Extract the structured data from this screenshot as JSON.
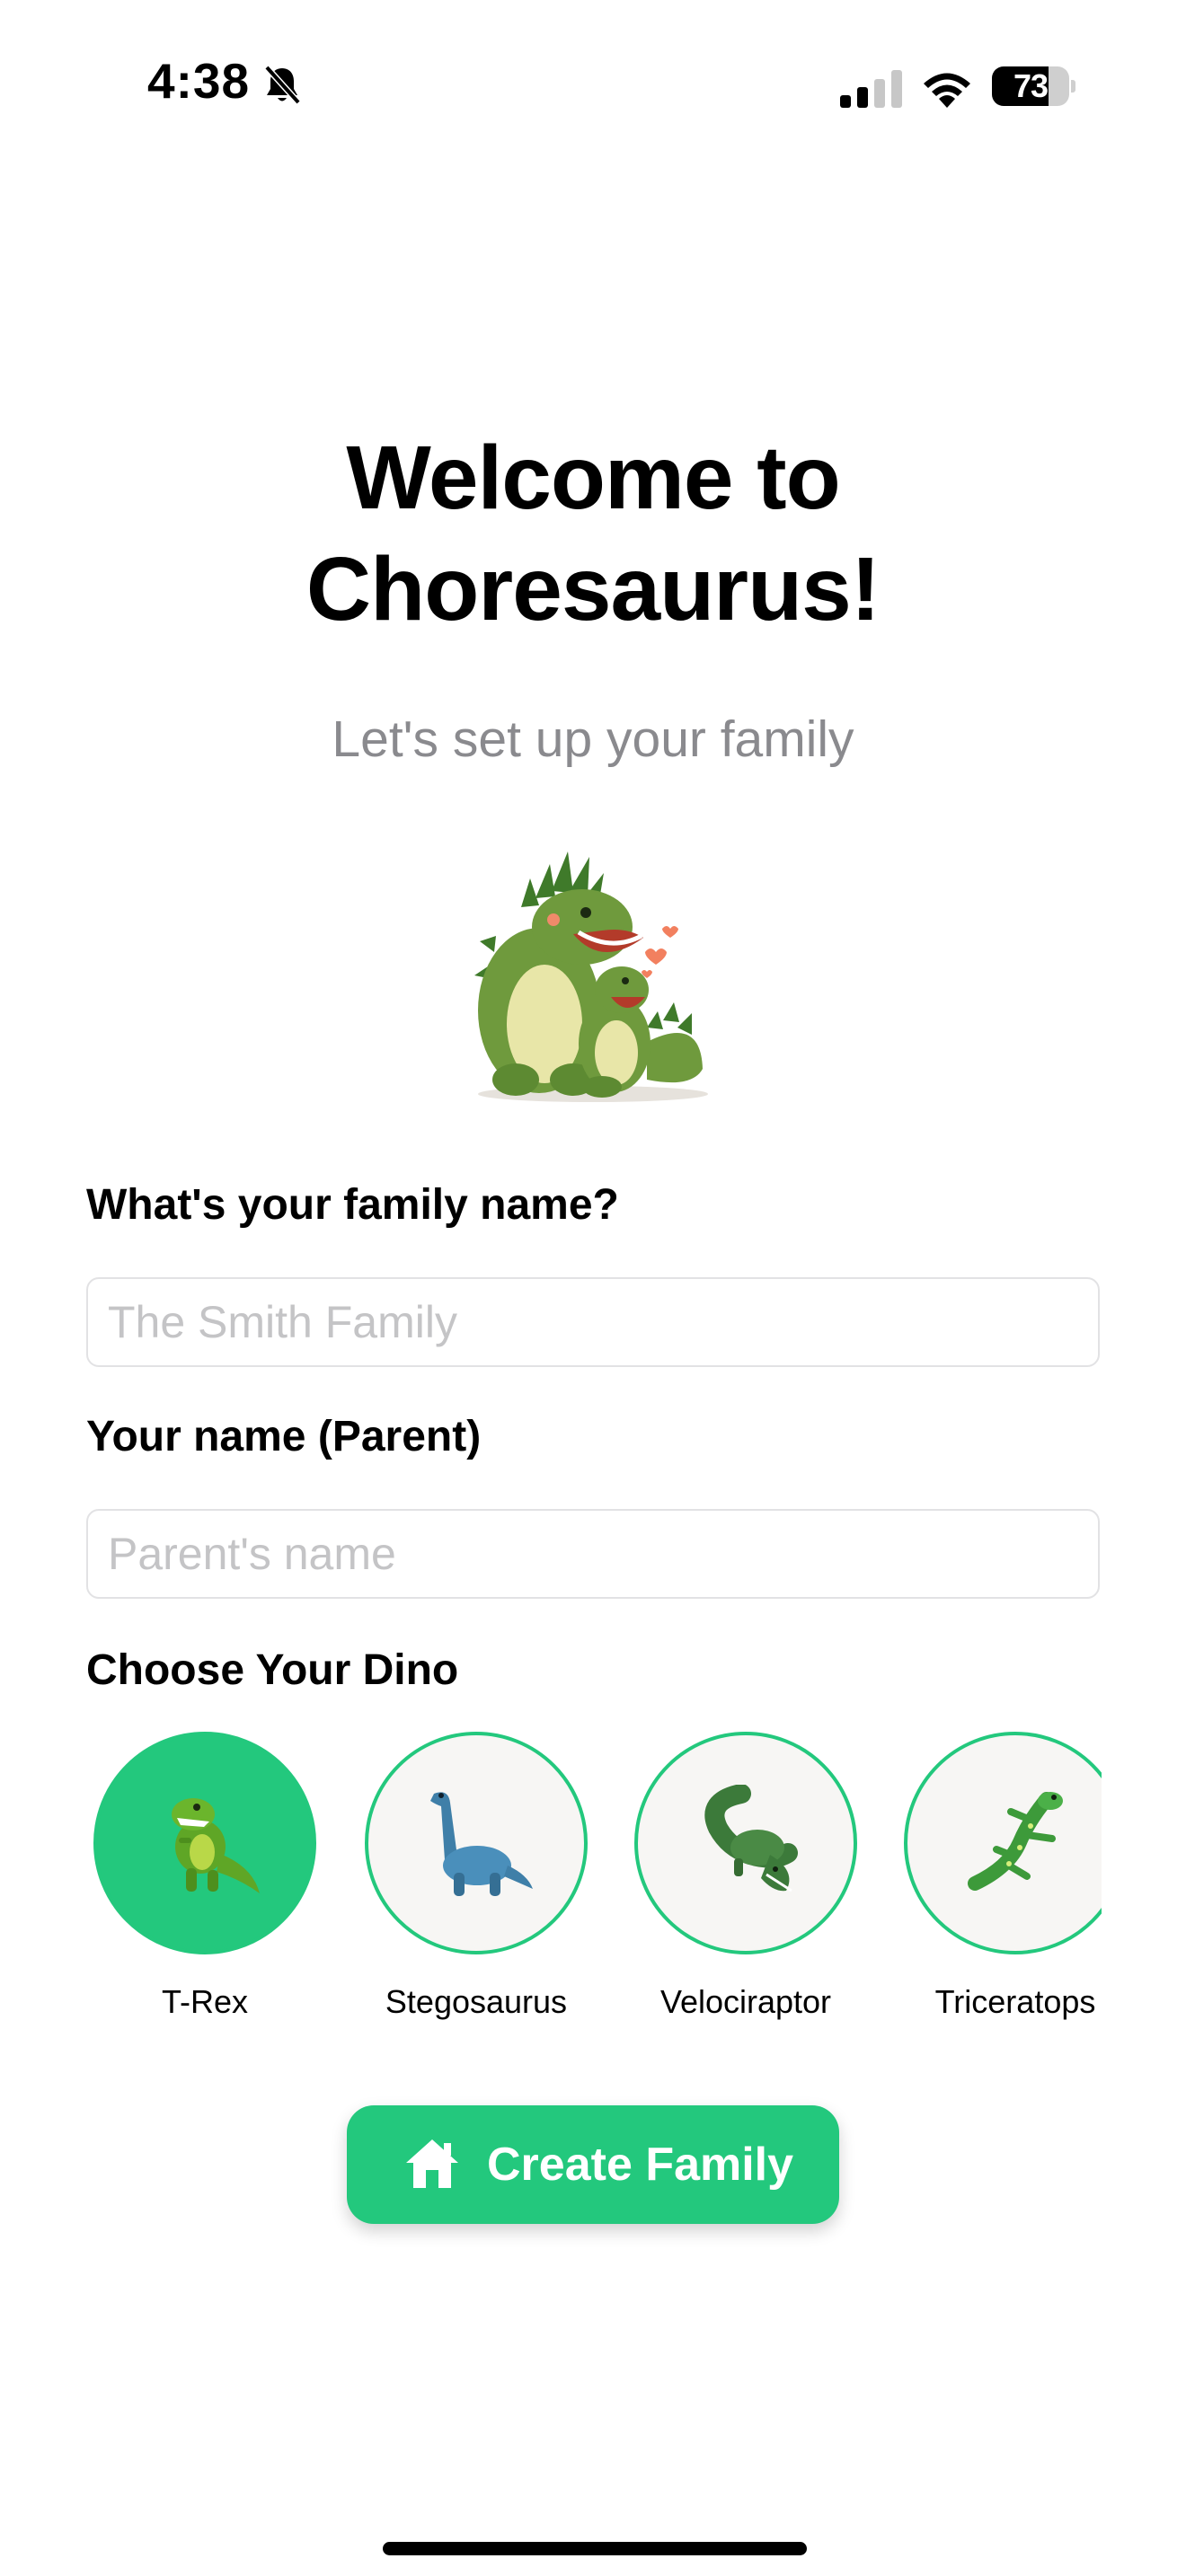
{
  "status_bar": {
    "time": "4:38",
    "battery": "73",
    "battery_level": 0.73
  },
  "welcome": {
    "title_line1": "Welcome to",
    "title_line2": "Choresaurus!",
    "subtitle": "Let's set up your family"
  },
  "form": {
    "family_name_label": "What's your family name?",
    "family_name_placeholder": "The Smith Family",
    "family_name_value": "",
    "parent_name_label": "Your name (Parent)",
    "parent_name_placeholder": "Parent's name",
    "parent_name_value": "",
    "dino_label": "Choose Your Dino"
  },
  "dinos": [
    {
      "name": "T-Rex",
      "icon": "t-rex-icon",
      "selected": true
    },
    {
      "name": "Stegosaurus",
      "icon": "sauropod-icon",
      "selected": false
    },
    {
      "name": "Velociraptor",
      "icon": "crocodile-icon",
      "selected": false
    },
    {
      "name": "Triceratops",
      "icon": "lizard-icon",
      "selected": false
    }
  ],
  "actions": {
    "create_family_label": "Create Family",
    "create_family_icon": "home-icon"
  },
  "colors": {
    "accent": "#23c87d",
    "subtitle": "#8a8a8e",
    "placeholder": "#c4c4c6",
    "input_border": "#e2e2e4"
  }
}
